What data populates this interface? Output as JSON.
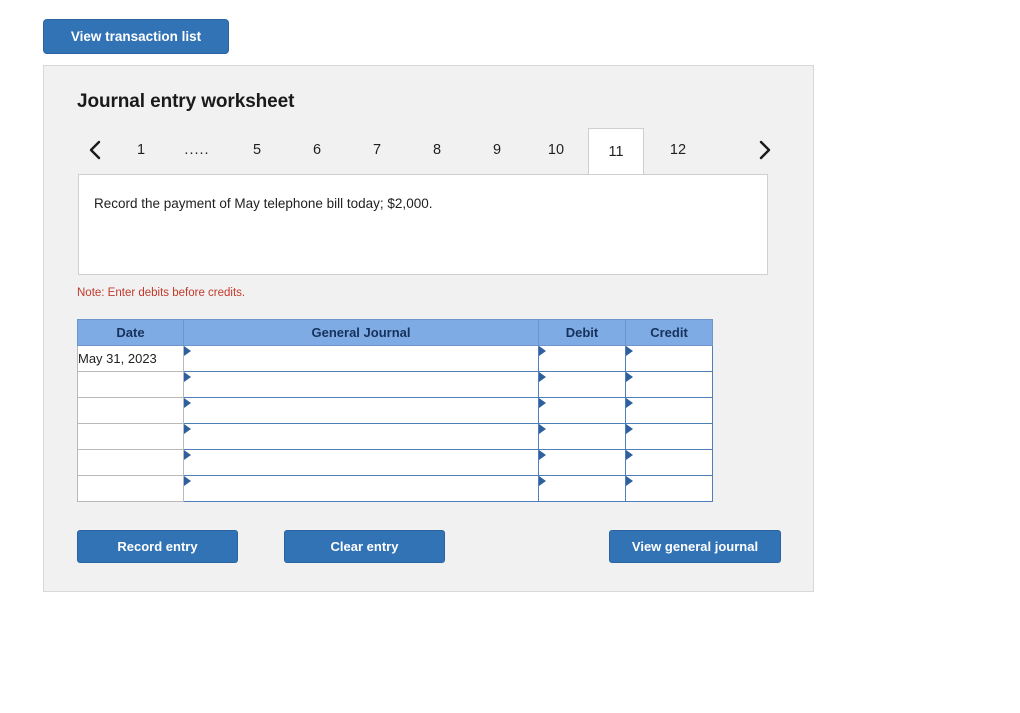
{
  "top_action": {
    "label": "View transaction list",
    "name": "view-transaction-list-button"
  },
  "worksheet": {
    "title": "Journal entry worksheet",
    "note": "Note: Enter debits before credits.",
    "prompt": "Record the payment of May telephone bill today; $2,000.",
    "prev_icon": "chevron-left-icon",
    "next_icon": "chevron-right-icon",
    "tabs": [
      {
        "label": "1",
        "active": false
      },
      {
        "label": ".....",
        "active": false
      },
      {
        "label": "5",
        "active": false
      },
      {
        "label": "6",
        "active": false
      },
      {
        "label": "7",
        "active": false
      },
      {
        "label": "8",
        "active": false
      },
      {
        "label": "9",
        "active": false
      },
      {
        "label": "10",
        "active": false
      },
      {
        "label": "11",
        "active": true
      },
      {
        "label": "12",
        "active": false
      }
    ]
  },
  "table": {
    "headers": {
      "date": "Date",
      "general_journal": "General Journal",
      "debit": "Debit",
      "credit": "Credit"
    },
    "rows": [
      {
        "date": "May 31, 2023",
        "account": "",
        "debit": "",
        "credit": ""
      },
      {
        "date": "",
        "account": "",
        "debit": "",
        "credit": ""
      },
      {
        "date": "",
        "account": "",
        "debit": "",
        "credit": ""
      },
      {
        "date": "",
        "account": "",
        "debit": "",
        "credit": ""
      },
      {
        "date": "",
        "account": "",
        "debit": "",
        "credit": ""
      },
      {
        "date": "",
        "account": "",
        "debit": "",
        "credit": ""
      }
    ]
  },
  "actions": {
    "record": "Record entry",
    "clear": "Clear entry",
    "view_journal": "View general journal"
  },
  "colors": {
    "button_blue": "#3273b5",
    "header_blue": "#7fabe4",
    "header_text": "#16325c",
    "note_red": "#c0392b",
    "panel_bg": "#f1f1f1"
  }
}
